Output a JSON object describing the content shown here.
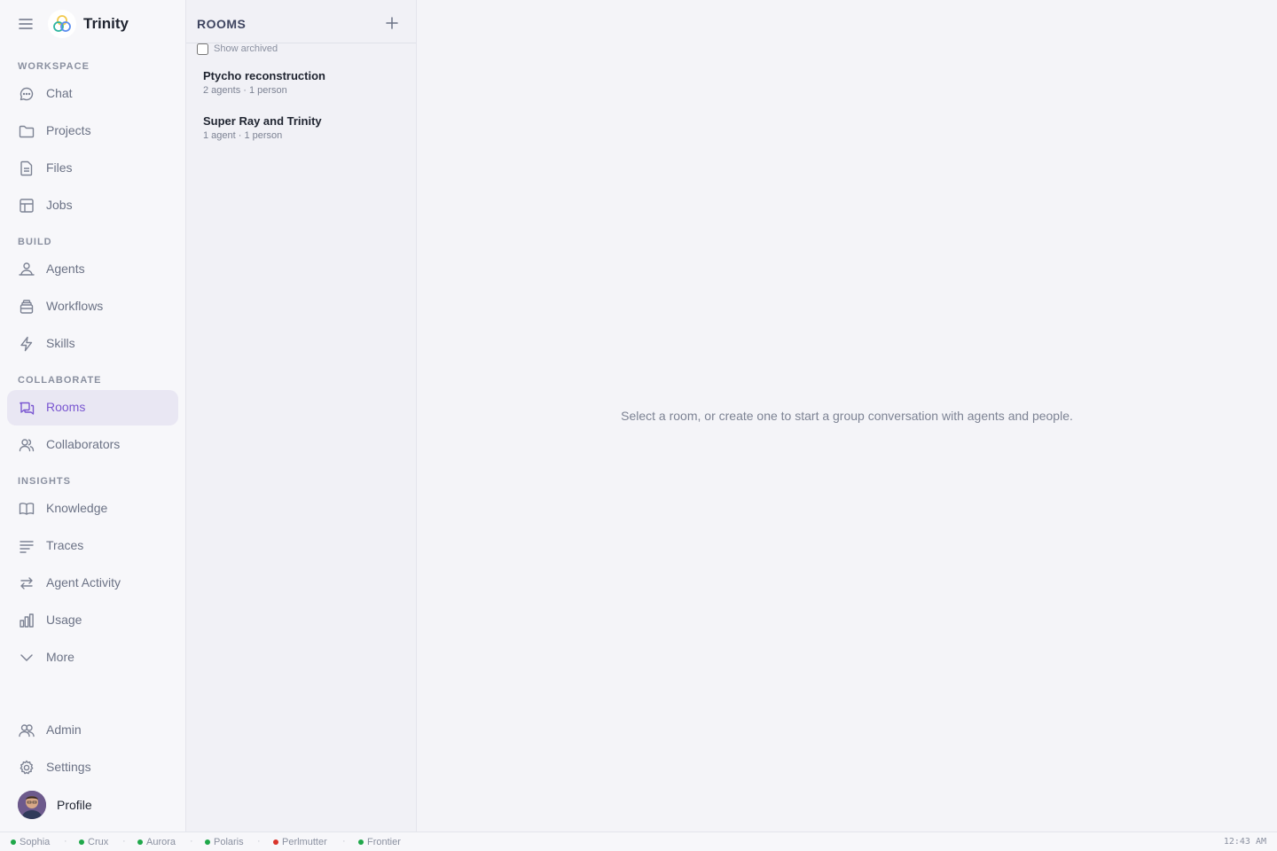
{
  "app": {
    "title": "Trinity"
  },
  "sidebar": {
    "sections": {
      "workspace": "WORKSPACE",
      "build": "BUILD",
      "collaborate": "COLLABORATE",
      "insights": "INSIGHTS"
    },
    "items": {
      "chat": {
        "label": "Chat",
        "icon": "chat-bubble-icon"
      },
      "projects": {
        "label": "Projects",
        "icon": "folder-icon"
      },
      "files": {
        "label": "Files",
        "icon": "file-icon"
      },
      "jobs": {
        "label": "Jobs",
        "icon": "table-icon"
      },
      "agents": {
        "label": "Agents",
        "icon": "agents-icon"
      },
      "workflows": {
        "label": "Workflows",
        "icon": "stack-icon"
      },
      "skills": {
        "label": "Skills",
        "icon": "lightning-icon"
      },
      "rooms": {
        "label": "Rooms",
        "icon": "rooms-icon",
        "active": true
      },
      "collaborators": {
        "label": "Collaborators",
        "icon": "users-icon"
      },
      "knowledge": {
        "label": "Knowledge",
        "icon": "book-icon"
      },
      "traces": {
        "label": "Traces",
        "icon": "lines-icon"
      },
      "agent_activity": {
        "label": "Agent Activity",
        "icon": "arrows-exchange-icon"
      },
      "usage": {
        "label": "Usage",
        "icon": "bar-chart-icon"
      },
      "more": {
        "label": "More",
        "icon": "chevron-down-icon"
      },
      "admin": {
        "label": "Admin",
        "icon": "admin-users-icon"
      },
      "settings": {
        "label": "Settings",
        "icon": "gear-icon"
      }
    },
    "profile": {
      "label": "Profile"
    }
  },
  "rooms_panel": {
    "title": "ROOMS",
    "show_archived_label": "Show archived",
    "show_archived_checked": false,
    "rooms": [
      {
        "name": "Ptycho reconstruction",
        "meta": "2 agents · 1 person"
      },
      {
        "name": "Super Ray and Trinity",
        "meta": "1 agent · 1 person"
      }
    ]
  },
  "main": {
    "empty_message": "Select a room, or create one to start a group conversation with agents and people."
  },
  "status_bar": {
    "services": [
      {
        "name": "Sophia",
        "status": "online"
      },
      {
        "name": "Crux",
        "status": "online"
      },
      {
        "name": "Aurora",
        "status": "online"
      },
      {
        "name": "Polaris",
        "status": "online"
      },
      {
        "name": "Perlmutter",
        "status": "offline"
      },
      {
        "name": "Frontier",
        "status": "online"
      }
    ],
    "status_colors": {
      "online": "#1fa84a",
      "offline": "#d9352b"
    },
    "separator": "·",
    "clock": "12:43 AM"
  },
  "colors": {
    "accent": "#7a57d1",
    "active_bg": "#e9e7f3",
    "muted_text": "#6b7285"
  }
}
